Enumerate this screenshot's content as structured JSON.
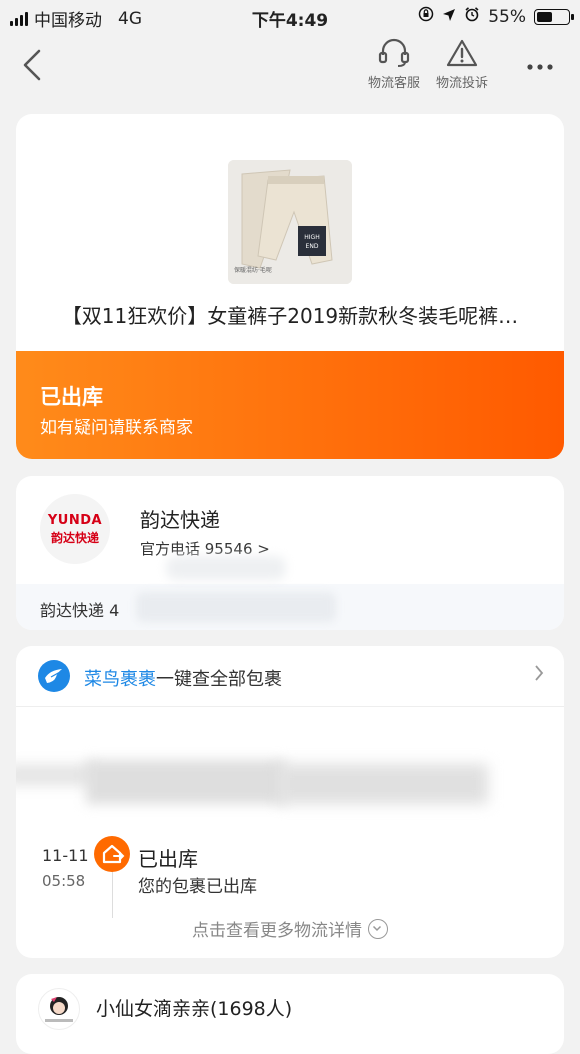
{
  "status_bar": {
    "carrier": "中国移动",
    "network": "4G",
    "time": "下午4:49",
    "battery": "55%",
    "battery_level": 0.55
  },
  "nav": {
    "service_label": "物流客服",
    "complaint_label": "物流投诉"
  },
  "product": {
    "title": "【双11狂欢价】女童裤子2019新款秋冬装毛呢裤…",
    "image_text": "保暖混纺·毛呢",
    "image_tag": "HIGH END"
  },
  "status": {
    "title": "已出库",
    "subtitle": "如有疑问请联系商家",
    "color_start": "#ff8b1a",
    "color_end": "#ff5a00"
  },
  "carrier": {
    "logo_en": "YUNDA",
    "logo_cn": "韵达快递",
    "name": "韵达快递",
    "phone": "官方电话 95546 >",
    "tracking_label": "韵达快递 4"
  },
  "cainiao": {
    "brand": "菜鸟裹裹",
    "text": "一键查全部包裹",
    "arrow": ">"
  },
  "timeline": {
    "date": "11-11",
    "time": "05:58",
    "title": "已出库",
    "desc": "您的包裹已出库",
    "more": "点击查看更多物流详情"
  },
  "shop": {
    "name": "小仙女滴亲亲(1698人)"
  }
}
